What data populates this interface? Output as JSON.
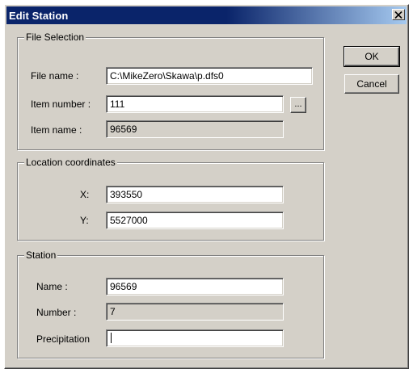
{
  "window": {
    "title": "Edit Station",
    "close_glyph": "✕"
  },
  "buttons": {
    "ok_label": "OK",
    "cancel_label": "Cancel",
    "browse_label": "..."
  },
  "file_selection": {
    "group_label": "File Selection",
    "file_name_label": "File name :",
    "file_name_value": "C:\\MikeZero\\Skawa\\p.dfs0",
    "item_number_label": "Item number :",
    "item_number_value": "111",
    "item_name_label": "Item name :",
    "item_name_value": "96569"
  },
  "location": {
    "group_label": "Location coordinates",
    "x_label": "X:",
    "x_value": "393550",
    "y_label": "Y:",
    "y_value": "5527000"
  },
  "station": {
    "group_label": "Station",
    "name_label": "Name :",
    "name_value": "96569",
    "number_label": "Number :",
    "number_value": "7",
    "precipitation_label": "Precipitation",
    "precipitation_value": ""
  },
  "colors": {
    "title_bar": "#0a246a",
    "dialog_face": "#d4d0c8"
  }
}
